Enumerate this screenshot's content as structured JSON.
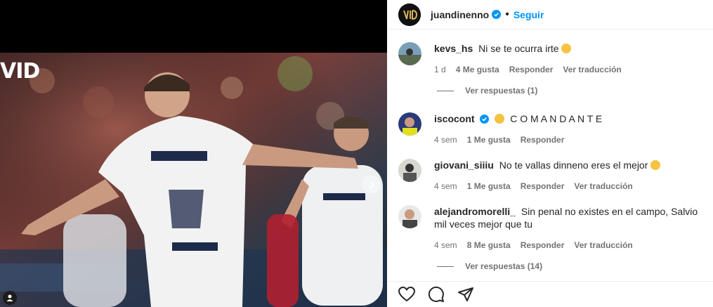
{
  "media": {
    "watermark": "VID",
    "next_icon": "chevron-right-icon",
    "tag_icon": "person-icon"
  },
  "header": {
    "username": "juandinenno",
    "separator": "•",
    "follow_label": "Seguir"
  },
  "comments": [
    {
      "username": "kevs_hs",
      "verified": false,
      "text": "Ni se te ocurra irte",
      "emoji": "pleading-face",
      "time": "1 d",
      "likes": "4 Me gusta",
      "reply": "Responder",
      "translate": "Ver traducción",
      "view_replies": "Ver respuestas (1)"
    },
    {
      "username": "iscocont",
      "verified": true,
      "text": "C O M A N D A N T E",
      "emoji": "saluting-face",
      "time": "4 sem",
      "likes": "1 Me gusta",
      "reply": "Responder"
    },
    {
      "username": "giovani_siiiu",
      "verified": false,
      "text": "No te vallas dinneno eres el mejor",
      "emoji": "heart-eyes",
      "time": "4 sem",
      "likes": "1 Me gusta",
      "reply": "Responder",
      "translate": "Ver traducción"
    },
    {
      "username": "alejandromorelli_",
      "verified": false,
      "text": "Sin penal no existes en el campo, Salvio mil veces mejor que tu",
      "time": "4 sem",
      "likes": "8 Me gusta",
      "reply": "Responder",
      "translate": "Ver traducción",
      "view_replies": "Ver respuestas (14)"
    }
  ],
  "actions": {
    "like_icon": "heart-icon",
    "comment_icon": "comment-icon",
    "share_icon": "share-icon"
  },
  "colors": {
    "accent": "#0095f6",
    "verified": "#0095f6",
    "muted": "#737373"
  }
}
